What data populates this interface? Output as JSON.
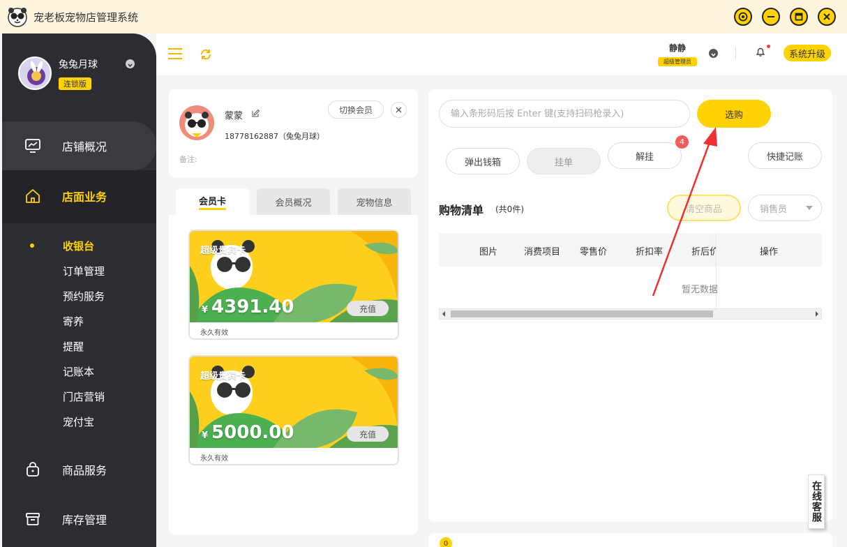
{
  "app": {
    "title": "宠老板宠物店管理系统"
  },
  "sidebar": {
    "user": {
      "name": "兔兔月球",
      "badge": "连锁版"
    },
    "menu": [
      {
        "label": "店铺概况",
        "icon": "monitor-icon"
      },
      {
        "label": "店面业务",
        "icon": "home-icon"
      },
      {
        "label": "商品服务",
        "icon": "bag-icon"
      },
      {
        "label": "库存管理",
        "icon": "box-icon"
      }
    ],
    "submenu": [
      "收银台",
      "订单管理",
      "预约服务",
      "寄养",
      "提醒",
      "记账本",
      "门店营销",
      "宠付宝"
    ],
    "active_submenu": "收银台"
  },
  "header": {
    "username": "静静",
    "role": "超级管理员",
    "upgrade_label": "系统升级"
  },
  "member": {
    "name": "蒙蒙",
    "phone": "18778162887（兔兔月球）",
    "note_label": "备注:",
    "switch_label": "切换会员"
  },
  "tabs": [
    {
      "label": "会员卡",
      "active": true
    },
    {
      "label": "会员概况",
      "active": false
    },
    {
      "label": "宠物信息",
      "active": false
    }
  ],
  "cards": [
    {
      "title": "超级贵宾卡",
      "currency": "¥",
      "balance": "4391.40",
      "recharge": "充值",
      "validity": "永久有效"
    },
    {
      "title": "超级贵宾卡",
      "currency": "¥",
      "balance": "5000.00",
      "recharge": "充值",
      "validity": "永久有效"
    }
  ],
  "checkout": {
    "scan_placeholder": "输入条形码后按 Enter 键(支持扫码枪录入)",
    "select_label": "选购",
    "buttons": {
      "cash_drawer": "弹出钱箱",
      "hold": "挂单",
      "unhold": "解挂",
      "quick_account": "快捷记账"
    },
    "unhold_count": "4",
    "cart_title": "购物清单",
    "cart_count": "(共0件)",
    "clear_label": "清空商品",
    "sales_placeholder": "销售员",
    "columns": [
      "图片",
      "消费项目",
      "零售价",
      "折扣率",
      "折后价",
      "操作"
    ],
    "empty_text": "暂无数据"
  },
  "bottom_badge": "0",
  "online_service": "在线客服",
  "colors": {
    "accent": "#ffd200",
    "sidebar": "#2c2d33",
    "titlebar": "#fdf5de",
    "badge_red": "#f25c5c"
  }
}
